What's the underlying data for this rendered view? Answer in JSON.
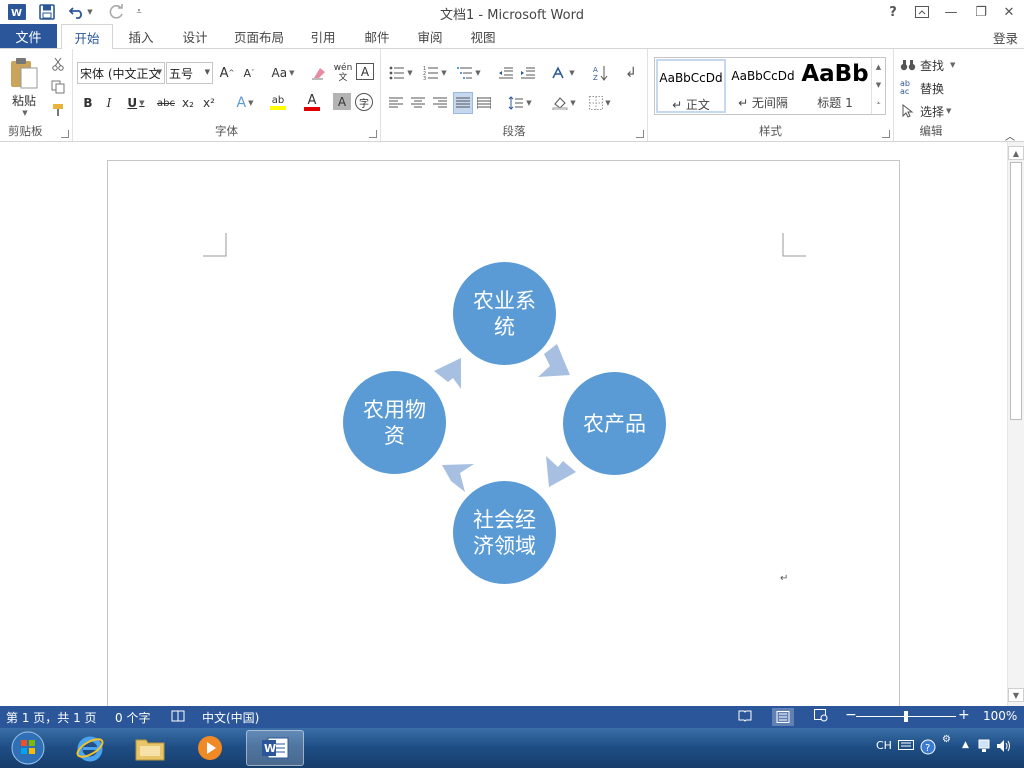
{
  "window": {
    "title": "文档1 - Microsoft Word",
    "help": "?",
    "min": "—",
    "restore": "❐",
    "close": "✕"
  },
  "tabs": {
    "file": "文件",
    "items": [
      "开始",
      "插入",
      "设计",
      "页面布局",
      "引用",
      "邮件",
      "审阅",
      "视图"
    ],
    "active": "开始",
    "login": "登录"
  },
  "ribbon": {
    "clipboard": {
      "label": "剪贴板",
      "paste": "粘贴"
    },
    "font": {
      "label": "字体",
      "font_name": "宋体 (中文正文",
      "font_size": "五号",
      "grow": "A",
      "shrink": "A",
      "case": "Aa",
      "phonetic": "wén\n文",
      "border_char": "A",
      "bold": "B",
      "italic": "I",
      "underline": "U",
      "strike": "abc",
      "sub": "x₂",
      "sup": "x²",
      "effects": "A",
      "highlight": "ab",
      "font_color": "A",
      "shade": "A",
      "enclose": "字"
    },
    "paragraph": {
      "label": "段落"
    },
    "styles": {
      "label": "样式",
      "items": [
        {
          "sample": "AaBbCcDd",
          "name": "↵ 正文"
        },
        {
          "sample": "AaBbCcDd",
          "name": "↵ 无间隔"
        },
        {
          "sample": "AaBb",
          "name": "标题 1"
        }
      ]
    },
    "editing": {
      "label": "编辑",
      "find": "查找",
      "replace": "替换",
      "select": "选择"
    }
  },
  "document": {
    "diagram": {
      "top": "农业系统",
      "right": "农产品",
      "bottom": "社会经济领域",
      "left": "农用物资",
      "color": "#5b9bd5",
      "arrow_color": "#a7bfe0"
    },
    "para_mark": "↵"
  },
  "status": {
    "page": "第 1 页，共 1 页",
    "words": "0 个字",
    "language": "中文(中国)",
    "zoom": "100%"
  },
  "taskbar": {
    "tray_lang": "CH"
  }
}
